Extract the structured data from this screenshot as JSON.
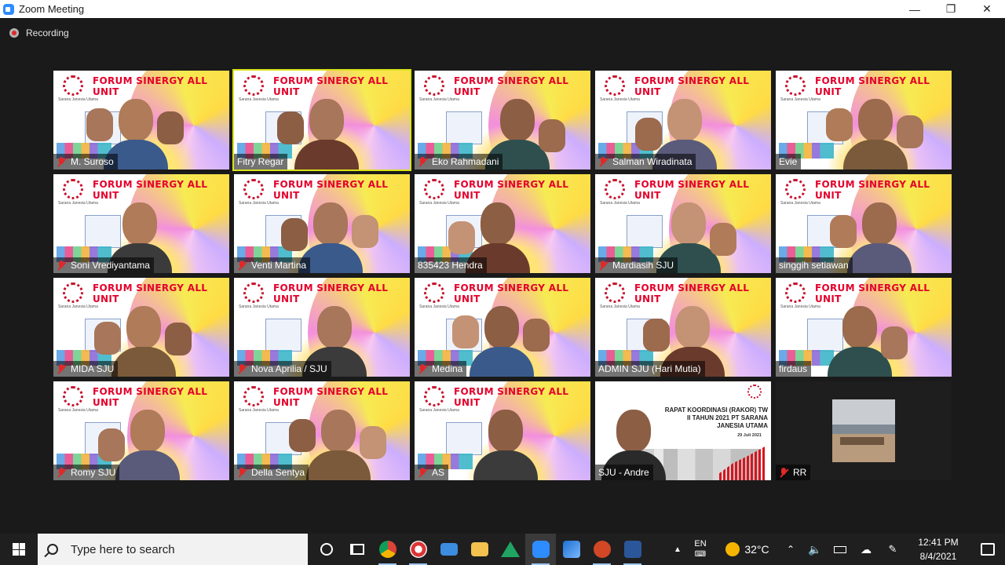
{
  "window": {
    "title": "Zoom Meeting",
    "minimize": "—",
    "restore": "❐",
    "close": "✕"
  },
  "recording": {
    "label": "Recording"
  },
  "banner_text": "FORUM SINERGY ALL UNIT",
  "company_text": "Sarana Janesia Utama",
  "active_speaker": "Fitry Regar",
  "participants": [
    {
      "name": "M. Suroso",
      "muted": true
    },
    {
      "name": "Fitry Regar",
      "muted": false
    },
    {
      "name": "Eko Rahmadani",
      "muted": true
    },
    {
      "name": "Salman Wiradinata",
      "muted": true
    },
    {
      "name": "Evie",
      "muted": false
    },
    {
      "name": "Soni Vrediyantama",
      "muted": true
    },
    {
      "name": "Venti Martina",
      "muted": true
    },
    {
      "name": "835423 Hendra",
      "muted": false
    },
    {
      "name": "Mardiasih SJU",
      "muted": true
    },
    {
      "name": "singgih setiawan",
      "muted": false
    },
    {
      "name": "MIDA SJU",
      "muted": true
    },
    {
      "name": "Nova Aprilia / SJU",
      "muted": true
    },
    {
      "name": "Medina",
      "muted": true
    },
    {
      "name": "ADMIN SJU (Hari Mutia)",
      "muted": false
    },
    {
      "name": "firdaus",
      "muted": false
    },
    {
      "name": "Romy SJU",
      "muted": true
    },
    {
      "name": "Della Sentya",
      "muted": true
    },
    {
      "name": "AS",
      "muted": true
    },
    {
      "name": "SJU - Andre",
      "muted": false
    },
    {
      "name": "RR",
      "muted": true
    }
  ],
  "rakor": {
    "title": "RAPAT KOORDINASI (RAKOR) TW II TAHUN 2021 PT SARANA JANESIA UTAMA",
    "date": "29 Juli 2021"
  },
  "taskbar": {
    "search_placeholder": "Type here to search",
    "language": "EN",
    "temperature": "32°C",
    "time": "12:41 PM",
    "date": "8/4/2021"
  },
  "colors": {
    "banner_red": "#e4002b",
    "active_outline": "#d9e31a",
    "muted_red": "#e02828"
  }
}
